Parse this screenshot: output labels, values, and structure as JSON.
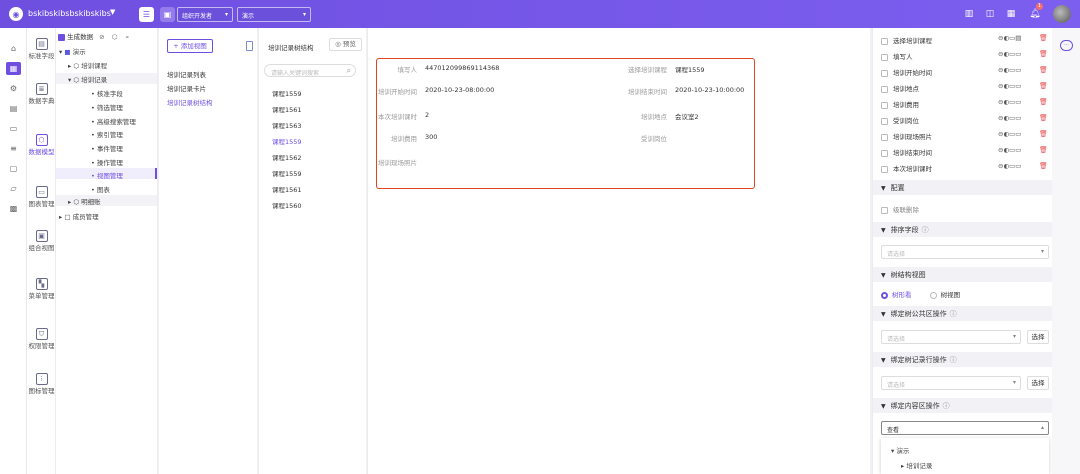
{
  "topbar": {
    "app_name": "bskibskibsbskibskibs",
    "org_select": "组织开发者",
    "project_select": "演示",
    "notification_count": "1",
    "colors": {
      "brand": "#6e4fe0"
    }
  },
  "module_nav": [
    {
      "label": "标准字段",
      "icon": "standard-field-icon"
    },
    {
      "label": "数据字典",
      "icon": "dictionary-icon"
    },
    {
      "label": "数据模型",
      "icon": "data-model-icon"
    },
    {
      "label": "图表管理",
      "icon": "chart-icon"
    },
    {
      "label": "组合视图",
      "icon": "combo-view-icon"
    },
    {
      "label": "菜单管理",
      "icon": "menu-icon"
    },
    {
      "label": "权限管理",
      "icon": "permission-icon"
    },
    {
      "label": "图标管理",
      "icon": "icon-manage-icon"
    }
  ],
  "tree": {
    "generate_label": "生成数据",
    "nodes": {
      "root": "演示",
      "course": "培训课程",
      "record": "培训记录",
      "c1": "核准字段",
      "c2": "筛选管理",
      "c3": "高级搜索管理",
      "c4": "索引管理",
      "c5": "事件管理",
      "c6": "操作管理",
      "c7": "视图管理",
      "c8": "图表",
      "detail": "明细账",
      "members": "成员管理"
    }
  },
  "views": {
    "add_button": "添加视图",
    "items": [
      "培训记录列表",
      "培训记录卡片",
      "培训记录树结构"
    ]
  },
  "structure": {
    "title": "培训记录树结构",
    "preview": "预览",
    "search_placeholder": "请输入关键词搜索",
    "items": [
      "课程1559",
      "课程1561",
      "课程1563",
      "课程1559",
      "课程1562",
      "课程1559",
      "课程1561",
      "课程1560"
    ]
  },
  "form": {
    "writer_label": "填写人",
    "writer_value": "447012099869114368",
    "course_label": "选择培训课程",
    "course_value": "课程1559",
    "start_label": "培训开始时间",
    "start_value": "2020-10-23-08:00:00",
    "end_label": "培训结束时间",
    "end_value": "2020-10-23-10:00:00",
    "hours_label": "本次培训课时",
    "hours_value": "2",
    "place_label": "培训地点",
    "place_value": "会议室2",
    "fee_label": "培训费用",
    "fee_value": "300",
    "post_label": "受训岗位",
    "post_value": "",
    "photo_label": "培训现场照片"
  },
  "props": {
    "fields": [
      "选择培训课程",
      "填写人",
      "培训开始时间",
      "培训地点",
      "培训费用",
      "受训岗位",
      "培训现场照片",
      "培训结束时间",
      "本次培训课时"
    ],
    "config_title": "配置",
    "cascade_delete": "级联删除",
    "sort_title": "排序字段",
    "sort_placeholder": "请选择",
    "tree_view_title": "树结构视图",
    "radio_tree": "树形看",
    "radio_view": "树视图",
    "public_op_title": "绑定树公共区操作",
    "public_op_placeholder": "请选择",
    "row_op_title": "绑定树记录行操作",
    "row_op_placeholder": "请选择",
    "content_op_title": "绑定内容区操作",
    "content_op_value": "查看",
    "choose_label": "选择",
    "dropdown_root": "演示",
    "dropdown_child": "培训记录"
  }
}
